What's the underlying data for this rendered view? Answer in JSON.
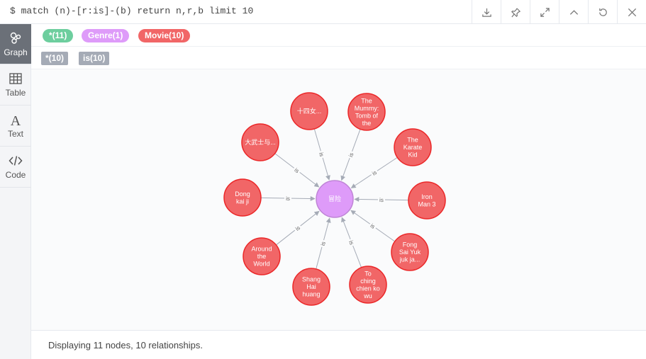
{
  "query": "$ match (n)-[r:is]-(b) return n,r,b limit 10",
  "toolbar": {
    "icons": [
      "download-icon",
      "pin-icon",
      "expand-icon",
      "collapse-icon",
      "rerun-icon",
      "close-icon"
    ]
  },
  "sidebar": {
    "items": [
      {
        "label": "Graph",
        "icon": "graph-icon",
        "active": true
      },
      {
        "label": "Table",
        "icon": "table-icon",
        "active": false
      },
      {
        "label": "Text",
        "icon": "text-icon",
        "active": false
      },
      {
        "label": "Code",
        "icon": "code-icon",
        "active": false
      }
    ]
  },
  "legend": {
    "labels": [
      {
        "text": "*(11)",
        "color": "#6dce9e"
      },
      {
        "text": "Genre(1)",
        "color": "#de9bf9"
      },
      {
        "text": "Movie(10)",
        "color": "#f16667"
      }
    ],
    "relationships": [
      {
        "text": "*(10)"
      },
      {
        "text": "is(10)"
      }
    ]
  },
  "graph": {
    "colors": {
      "movie": "#f16667",
      "movie_border": "#eb2728",
      "genre": "#de9bf9",
      "genre_border": "#bf85d6",
      "edge": "#a5abb6"
    },
    "center": {
      "lines": [
        "冒险"
      ]
    },
    "relationship_label": "is",
    "nodes": [
      {
        "lines": [
          "十四女..."
        ]
      },
      {
        "lines": [
          "The",
          "Mummy:",
          "Tomb of",
          "the"
        ]
      },
      {
        "lines": [
          "The",
          "Karate",
          "Kid"
        ]
      },
      {
        "lines": [
          "Iron",
          "Man 3"
        ]
      },
      {
        "lines": [
          "Fong",
          "Sai Yuk",
          "juk ja..."
        ]
      },
      {
        "lines": [
          "To",
          "ching",
          "chien ko",
          "wu"
        ]
      },
      {
        "lines": [
          "Shang",
          "Hai",
          "huang"
        ]
      },
      {
        "lines": [
          "Around",
          "the",
          "World"
        ]
      },
      {
        "lines": [
          "Dong",
          "kai ji"
        ]
      },
      {
        "lines": [
          "大武士与..."
        ]
      }
    ]
  },
  "status": {
    "text": "Displaying 11 nodes, 10 relationships."
  }
}
